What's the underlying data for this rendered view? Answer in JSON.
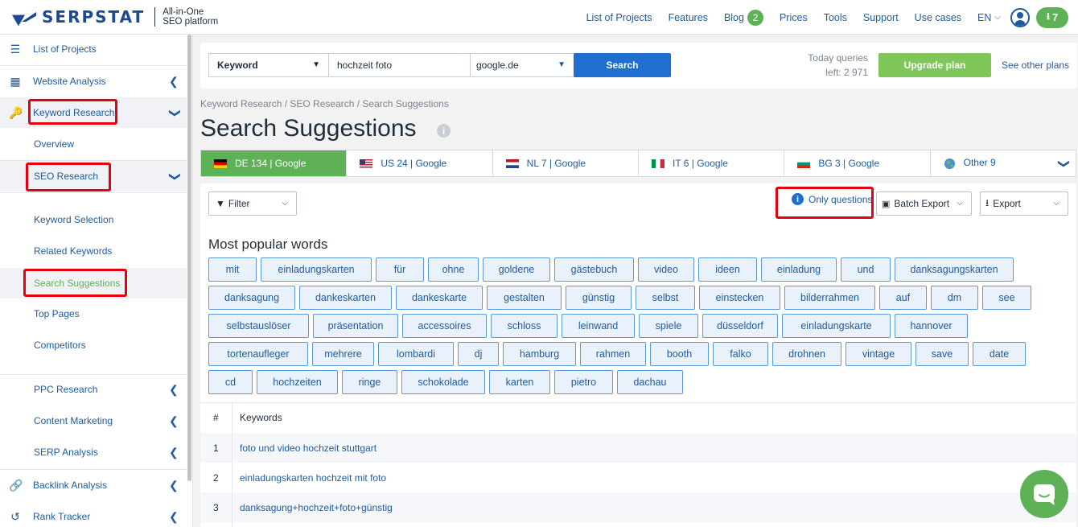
{
  "header": {
    "logo_text": "SERPSTAT",
    "tagline_line1": "All-in-One",
    "tagline_line2": "SEO platform",
    "nav": [
      "List of Projects",
      "Features",
      "Blog",
      "Prices",
      "Tools",
      "Support",
      "Use cases"
    ],
    "blog_badge": "2",
    "language": "EN",
    "downloads_count": "7"
  },
  "sidebar": {
    "list_of_projects": "List of Projects",
    "website_analysis": "Website Analysis",
    "keyword_research": "Keyword Research",
    "overview": "Overview",
    "seo_research": "SEO Research",
    "keyword_selection": "Keyword Selection",
    "related_keywords": "Related Keywords",
    "search_suggestions": "Search Suggestions",
    "top_pages": "Top Pages",
    "competitors": "Competitors",
    "ppc_research": "PPC Research",
    "content_marketing": "Content Marketing",
    "serp_analysis": "SERP Analysis",
    "backlink_analysis": "Backlink Analysis",
    "rank_tracker": "Rank Tracker"
  },
  "search": {
    "type_selected": "Keyword",
    "query_value": "hochzeit foto",
    "engine_selected": "google.de",
    "search_button": "Search",
    "today_queries_label": "Today queries",
    "queries_left": "left: 2 971",
    "upgrade_button": "Upgrade plan",
    "other_plans_link": "See other plans"
  },
  "breadcrumb": "Keyword Research / SEO Research / Search Suggestions",
  "page_title": "Search Suggestions",
  "db_tabs": [
    {
      "label": "DE 134 | Google",
      "flag": "de"
    },
    {
      "label": "US 24 | Google",
      "flag": "us"
    },
    {
      "label": "NL 7 | Google",
      "flag": "nl"
    },
    {
      "label": "IT 6 | Google",
      "flag": "it"
    },
    {
      "label": "BG 3 | Google",
      "flag": "bg"
    },
    {
      "label": "Other 9",
      "flag": "globe"
    }
  ],
  "toolbar": {
    "filter": "Filter",
    "only_questions": "Only questions",
    "batch_export": "Batch Export",
    "export": "Export"
  },
  "popular_title": "Most popular words",
  "popular_words": [
    [
      "mit",
      "einladungskarten",
      "für",
      "ohne",
      "goldene",
      "gästebuch",
      "video",
      "ideen",
      "einladung",
      "und",
      "danksagungskarten"
    ],
    [
      "danksagung",
      "dankeskarten",
      "dankeskarte",
      "gestalten",
      "günstig",
      "selbst",
      "einstecken",
      "bilderrahmen",
      "auf",
      "dm",
      "see"
    ],
    [
      "selbstauslöser",
      "präsentation",
      "accessoires",
      "schloss",
      "leinwand",
      "spiele",
      "düsseldorf",
      "einladungskarte",
      "hannover"
    ],
    [
      "tortenaufleger",
      "mehrere",
      "lombardi",
      "dj",
      "hamburg",
      "rahmen",
      "booth",
      "falko",
      "drohnen",
      "vintage",
      "save",
      "date"
    ],
    [
      "cd",
      "hochzeiten",
      "ringe",
      "schokolade",
      "karten",
      "pietro",
      "dachau"
    ]
  ],
  "table": {
    "col_num": "#",
    "col_keywords": "Keywords",
    "rows": [
      {
        "n": "1",
        "keyword": "foto und video hochzeit stuttgart"
      },
      {
        "n": "2",
        "keyword": "einladungskarten hochzeit mit foto"
      },
      {
        "n": "3",
        "keyword": "danksagung+hochzeit+foto+günstig"
      }
    ]
  },
  "colors": {
    "brand_blue": "#1e4a8e",
    "link_blue": "#1f5b9c",
    "green": "#5fb158",
    "highlight_red": "#e3000f"
  }
}
